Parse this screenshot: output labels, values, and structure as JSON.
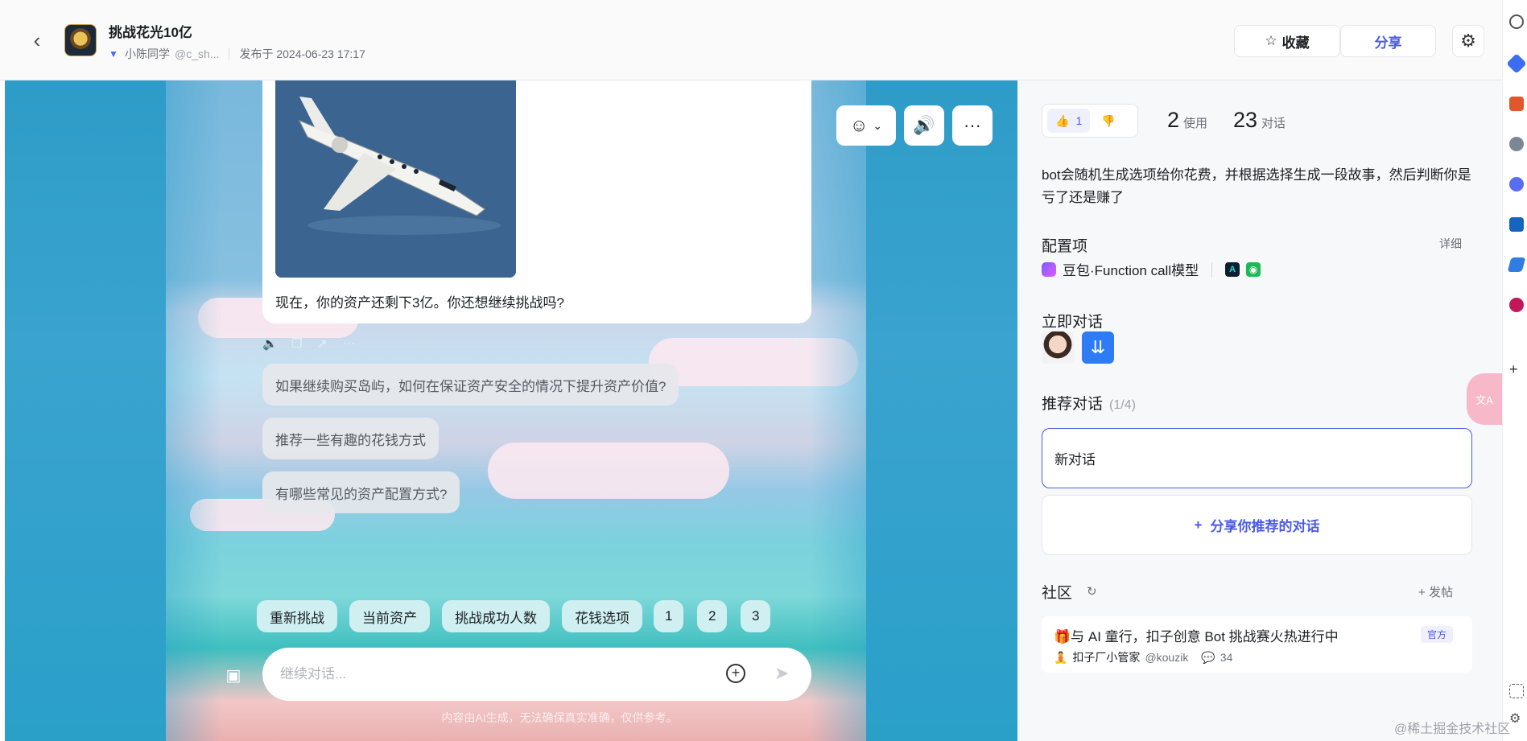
{
  "header": {
    "title": "挑战花光10亿",
    "author": "小陈同学",
    "handle": "@c_sh...",
    "published": "发布于 2024-06-23 17:17",
    "favorite_label": "收藏",
    "share_label": "分享"
  },
  "chat": {
    "message_text": "现在，你的资产还剩下3亿。你还想继续挑战吗?",
    "suggestions": [
      "如果继续购买岛屿，如何在保证资产安全的情况下提升资产价值?",
      "推荐一些有趣的花钱方式",
      "有哪些常见的资产配置方式?"
    ],
    "quick_replies": [
      "重新挑战",
      "当前资产",
      "挑战成功人数",
      "花钱选项",
      "1",
      "2",
      "3"
    ],
    "input_placeholder": "继续对话...",
    "disclaimer": "内容由AI生成，无法确保真实准确，仅供参考。"
  },
  "panel": {
    "likes": "1",
    "uses_num": "2",
    "uses_label": "使用",
    "chats_num": "23",
    "chats_label": "对话",
    "description": "bot会随机生成选项给你花费，并根据选择生成一段故事，然后判断你是亏了还是赚了",
    "config_title": "配置项",
    "detail_label": "详细",
    "model_name": "豆包·Function call模型",
    "chat_now_title": "立即对话",
    "recommend_title": "推荐对话",
    "recommend_count": "(1/4)",
    "recommend_item": "新对话",
    "share_recommend_label": "分享你推荐的对话",
    "community_title": "社区",
    "post_label": "发帖",
    "post": {
      "title": "与 AI 童行，扣子创意 Bot 挑战赛火热进行中",
      "tag": "官方",
      "author": "扣子厂小管家",
      "handle": "@kouzik",
      "comments": "34"
    }
  },
  "watermark": "@稀土掘金技术社区",
  "colors": {
    "accent": "#4b5ae6",
    "sky": "#2e9cc8"
  }
}
